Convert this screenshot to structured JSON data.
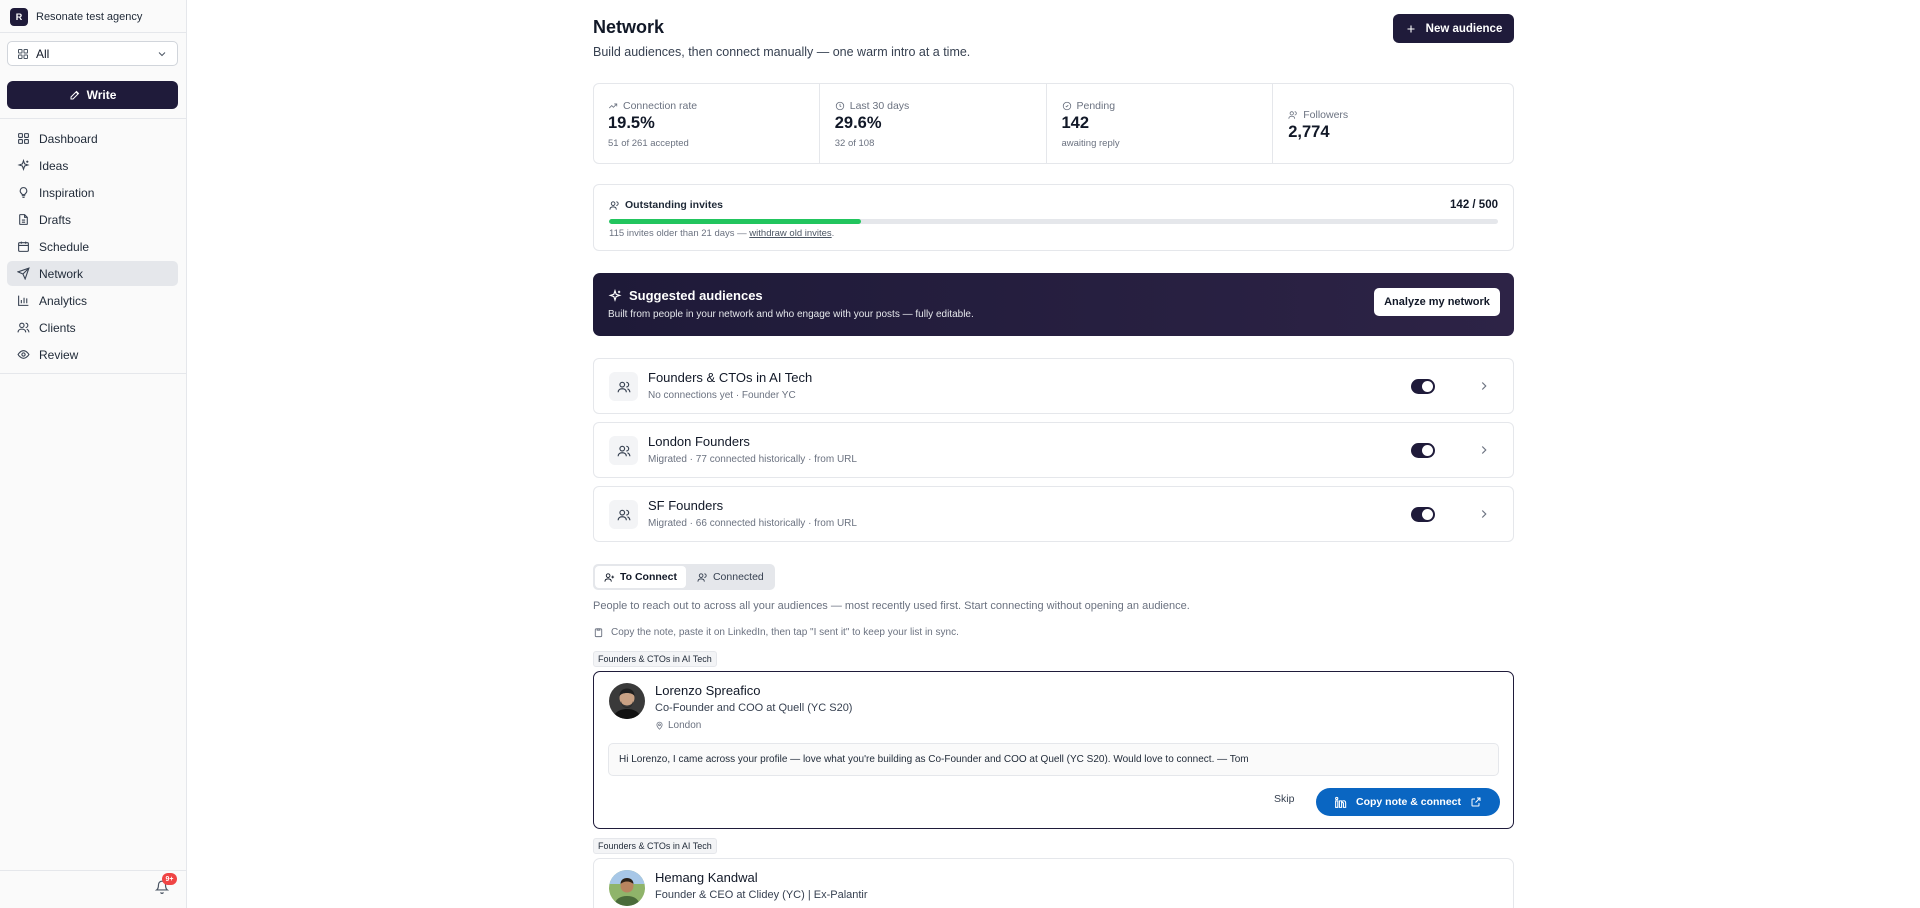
{
  "sidebar": {
    "org_initial": "R",
    "org_name": "Resonate test agency",
    "scope_selected": "All",
    "write_label": "Write",
    "items": [
      {
        "label": "Dashboard",
        "icon": "grid-icon"
      },
      {
        "label": "Ideas",
        "icon": "sparkles-icon"
      },
      {
        "label": "Inspiration",
        "icon": "lightbulb-icon"
      },
      {
        "label": "Drafts",
        "icon": "file-icon"
      },
      {
        "label": "Schedule",
        "icon": "calendar-icon"
      },
      {
        "label": "Network",
        "icon": "send-icon",
        "active": true
      },
      {
        "label": "Analytics",
        "icon": "bar-chart-icon"
      },
      {
        "label": "Clients",
        "icon": "users-icon"
      },
      {
        "label": "Review",
        "icon": "eye-icon"
      }
    ],
    "notifications_badge": "9+"
  },
  "header": {
    "title": "Network",
    "subtitle": "Build audiences, then connect manually — one warm intro at a time.",
    "new_audience_label": "New audience"
  },
  "stats": [
    {
      "label": "Connection rate",
      "value": "19.5%",
      "sub": "51 of 261 accepted",
      "icon": "trending-up-icon"
    },
    {
      "label": "Last 30 days",
      "value": "29.6%",
      "sub": "32 of 108",
      "icon": "clock-icon"
    },
    {
      "label": "Pending",
      "value": "142",
      "sub": "awaiting reply",
      "icon": "clock-circle-icon"
    },
    {
      "label": "Followers",
      "value": "2,774",
      "sub": "",
      "icon": "users-icon"
    }
  ],
  "invites": {
    "label": "Outstanding invites",
    "count": "142 / 500",
    "progress": 0.284,
    "note_prefix": "115 invites older than 21 days — ",
    "note_link": "withdraw old invites",
    "note_suffix": "."
  },
  "suggested": {
    "title": "Suggested audiences",
    "subtitle": "Built from people in your network and who engage with your posts — fully editable.",
    "button": "Analyze my network"
  },
  "audiences": [
    {
      "name": "Founders & CTOs in AI Tech",
      "meta": "No connections yet · Founder YC",
      "enabled": true
    },
    {
      "name": "London Founders",
      "meta": "Migrated · 77 connected historically · from URL",
      "enabled": true
    },
    {
      "name": "SF Founders",
      "meta": "Migrated · 66 connected historically · from URL",
      "enabled": true
    }
  ],
  "tabs": [
    {
      "label": "To Connect",
      "active": true
    },
    {
      "label": "Connected",
      "active": false
    }
  ],
  "to_connect": {
    "description": "People to reach out to across all your audiences — most recently used first. Start connecting without opening an audience.",
    "hint": "Copy the note, paste it on LinkedIn, then tap \"I sent it\" to keep your list in sync.",
    "people": [
      {
        "audience": "Founders & CTOs in AI Tech",
        "name": "Lorenzo Spreafico",
        "title": "Co-Founder and COO at Quell (YC S20)",
        "location": "London",
        "note": "Hi Lorenzo, I came across your profile — love what you're building as Co-Founder and COO at Quell (YC S20). Would love to connect. — Tom",
        "skip_label": "Skip",
        "connect_label": "Copy note & connect"
      },
      {
        "audience": "Founders & CTOs in AI Tech",
        "name": "Hemang Kandwal",
        "title": "Founder & CEO at Clidey (YC) | Ex-Palantir"
      }
    ]
  },
  "colors": {
    "brand_dark": "#1f1b3a",
    "progress_green": "#22c55e",
    "linkedin_blue": "#0a66c2"
  }
}
